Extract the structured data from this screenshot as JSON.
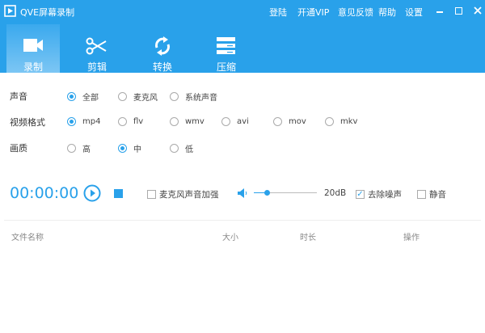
{
  "window": {
    "title": "QVE屏幕录制",
    "menu": [
      "登陆",
      "开通VIP",
      "意见反馈",
      "帮助",
      "设置"
    ],
    "accent": "#29a1ea"
  },
  "tabs": [
    {
      "label": "录制",
      "icon": "video-camera-icon",
      "active": true
    },
    {
      "label": "剪辑",
      "icon": "scissors-icon"
    },
    {
      "label": "转换",
      "icon": "refresh-icon"
    },
    {
      "label": "压缩",
      "icon": "server-stack-icon"
    }
  ],
  "settings": {
    "sound": {
      "label": "声音",
      "options": [
        "全部",
        "麦克风",
        "系统声音"
      ],
      "selected": 0
    },
    "format": {
      "label": "视频格式",
      "options": [
        "mp4",
        "flv",
        "wmv",
        "avi",
        "mov",
        "mkv"
      ],
      "selected": 0
    },
    "quality": {
      "label": "画质",
      "options": [
        "高",
        "中",
        "低"
      ],
      "selected": 1
    }
  },
  "controls": {
    "timer": "00:00:00",
    "mic_boost": {
      "label": "麦克风声音加强",
      "checked": false
    },
    "volume": {
      "value": "20dB",
      "level": 0.2
    },
    "denoise": {
      "label": "去除噪声",
      "checked": true
    },
    "mute": {
      "label": "静音",
      "checked": false
    }
  },
  "table": {
    "columns": [
      "文件名称",
      "大小",
      "时长",
      "操作"
    ]
  }
}
